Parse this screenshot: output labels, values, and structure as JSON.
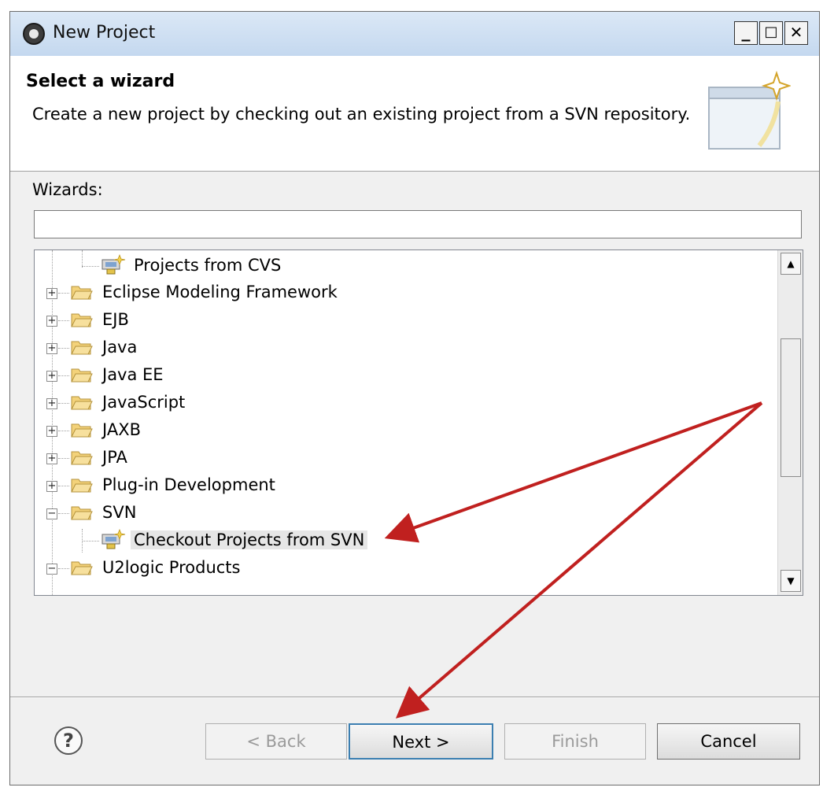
{
  "window": {
    "title": "New Project",
    "minimize_label": "_",
    "maximize_label": "□",
    "close_label": "✕"
  },
  "header": {
    "title": "Select a wizard",
    "description": "Create a new project by checking out an existing project from a SVN repository."
  },
  "wizards": {
    "label": "Wizards:",
    "filter_value": "",
    "filter_placeholder": ""
  },
  "tree": {
    "items": [
      {
        "label": "Projects from CVS",
        "type": "repository",
        "icon": "cvs-repository-icon"
      },
      {
        "label": "Eclipse Modeling Framework",
        "type": "folder",
        "expanded": false
      },
      {
        "label": "EJB",
        "type": "folder",
        "expanded": false
      },
      {
        "label": "Java",
        "type": "folder",
        "expanded": false
      },
      {
        "label": "Java EE",
        "type": "folder",
        "expanded": false
      },
      {
        "label": "JavaScript",
        "type": "folder",
        "expanded": false
      },
      {
        "label": "JAXB",
        "type": "folder",
        "expanded": false
      },
      {
        "label": "JPA",
        "type": "folder",
        "expanded": false
      },
      {
        "label": "Plug-in Development",
        "type": "folder",
        "expanded": false
      },
      {
        "label": "SVN",
        "type": "folder",
        "expanded": true
      },
      {
        "label": "Checkout Projects from SVN",
        "type": "repository",
        "icon": "svn-repository-icon",
        "selected": true
      },
      {
        "label": "U2logic Products",
        "type": "folder",
        "expanded": true
      }
    ]
  },
  "buttons": {
    "back": "< Back",
    "next": "Next >",
    "finish": "Finish",
    "cancel": "Cancel",
    "help_glyph": "?"
  },
  "colors": {
    "arrow": "#c0201f",
    "folder": "#f3d27a",
    "title_bar": "#c4d8ef",
    "default_button_border": "#3c7fb1"
  }
}
